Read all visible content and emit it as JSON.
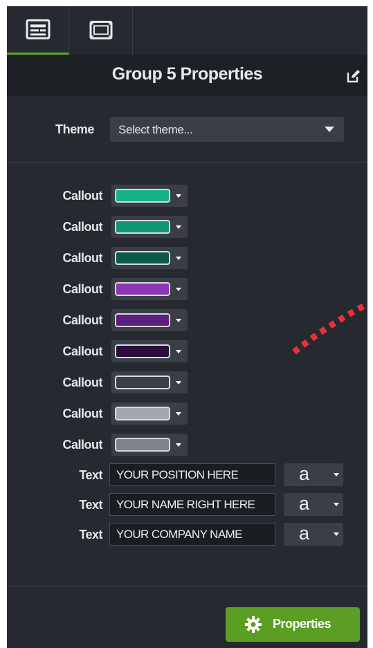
{
  "tabs": [
    {
      "icon": "properties-panel-icon",
      "active": true
    },
    {
      "icon": "film-strip-icon",
      "active": false
    }
  ],
  "header": {
    "title": "Group 5 Properties",
    "edit_icon": "edit-icon"
  },
  "theme": {
    "label": "Theme",
    "value": "Select theme..."
  },
  "callouts": [
    {
      "label": "Callout",
      "color": "#16b087"
    },
    {
      "label": "Callout",
      "color": "#0f9573"
    },
    {
      "label": "Callout",
      "color": "#0a5a46"
    },
    {
      "label": "Callout",
      "color": "#8b36b2"
    },
    {
      "label": "Callout",
      "color": "#5c1f7e"
    },
    {
      "label": "Callout",
      "color": "#2a0f3d"
    },
    {
      "label": "Callout",
      "color": "#3b4047"
    },
    {
      "label": "Callout",
      "color": "#a4a7ab"
    },
    {
      "label": "Callout",
      "color": "#7f8286"
    }
  ],
  "texts": [
    {
      "label": "Text",
      "value": "YOUR POSITION HERE",
      "font_glyph": "a"
    },
    {
      "label": "Text",
      "value": "YOUR NAME RIGHT HERE",
      "font_glyph": "a"
    },
    {
      "label": "Text",
      "value": "YOUR COMPANY NAME",
      "font_glyph": "a"
    }
  ],
  "footer": {
    "button_label": "Properties",
    "button_icon": "gear-icon"
  },
  "colors": {
    "accent": "#5c9e23",
    "panel": "#262a30",
    "dots": "#e8313a"
  }
}
